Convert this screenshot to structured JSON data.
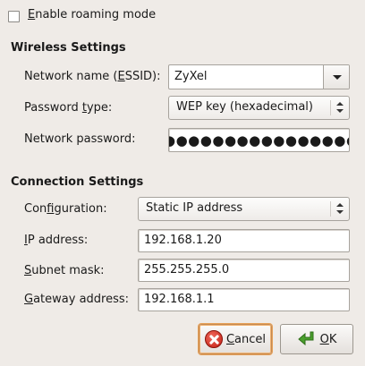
{
  "roaming": {
    "label_prefix": "",
    "mnemonic": "E",
    "label_rest": "nable roaming mode",
    "checked": false
  },
  "wireless": {
    "title": "Wireless Settings",
    "network_name": {
      "label_a": "Network name (",
      "mnemonic": "E",
      "label_b": "SSID):",
      "value": "ZyXel"
    },
    "password_type": {
      "label_a": "Password ",
      "mnemonic": "t",
      "label_b": "ype:",
      "value": "WEP key (hexadecimal)"
    },
    "network_password": {
      "label": "Network password:",
      "value": "●●●●●●●●●●●●●●●●●●"
    }
  },
  "connection": {
    "title": "Connection Settings",
    "configuration": {
      "label_a": "Con",
      "mnemonic": "f",
      "label_b": "iguration:",
      "value": "Static IP address"
    },
    "ip_address": {
      "mnemonic": "I",
      "label_b": "P address:",
      "value": "192.168.1.20"
    },
    "subnet_mask": {
      "mnemonic": "S",
      "label_b": "ubnet mask:",
      "value": "255.255.255.0"
    },
    "gateway": {
      "mnemonic": "G",
      "label_b": "ateway address:",
      "value": "192.168.1.1"
    }
  },
  "buttons": {
    "cancel": {
      "mnemonic": "C",
      "label_b": "ancel"
    },
    "ok": {
      "mnemonic": "O",
      "label_b": "K"
    }
  },
  "colors": {
    "background": "#efebe7",
    "focus_border": "#e7a158",
    "ok_arrow": "#4aa02c",
    "cancel_red": "#c21d12"
  }
}
